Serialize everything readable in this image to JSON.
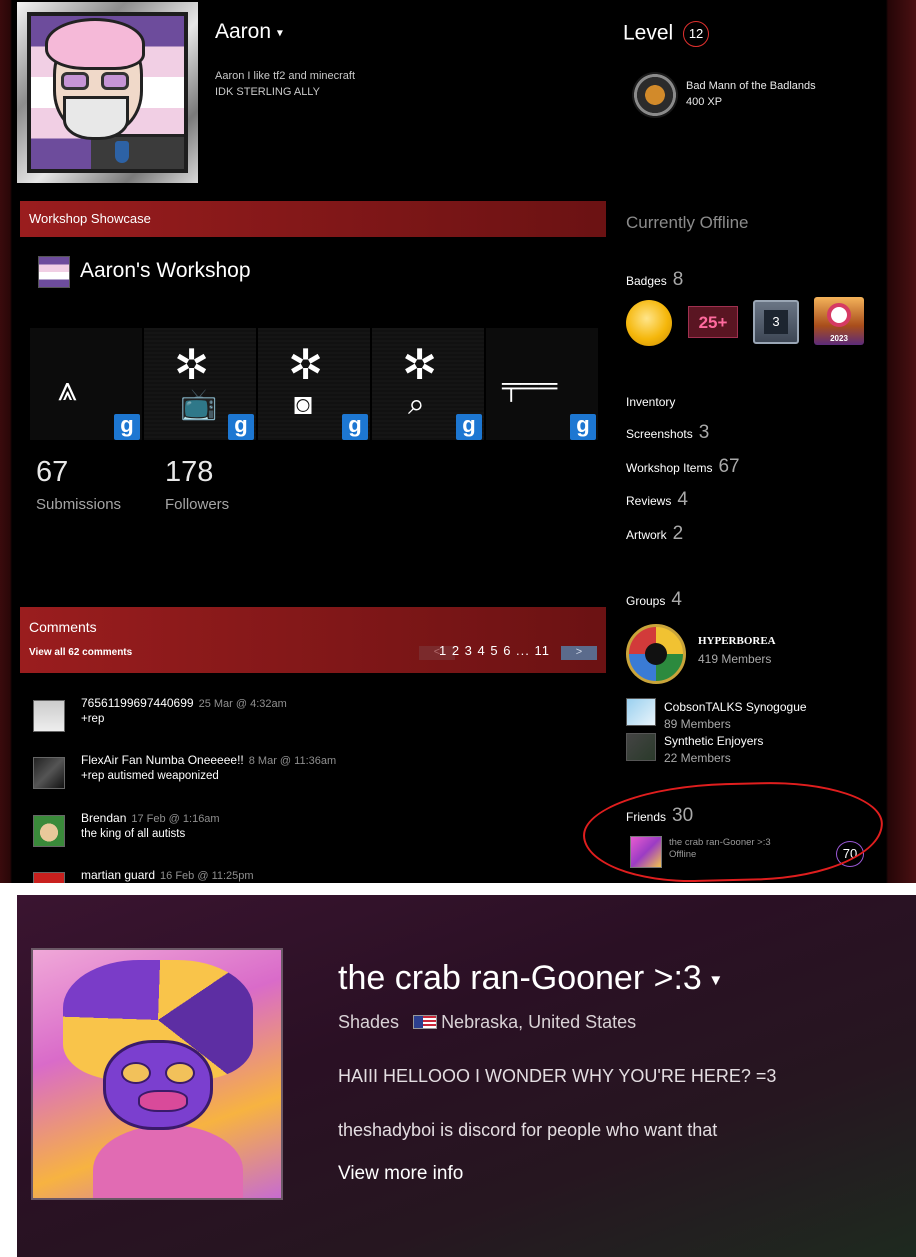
{
  "profile": {
    "name": "Aaron",
    "summary_line1": "Aaron I like tf2 and minecraft",
    "summary_line2": "IDK STERLING ALLY",
    "level_label": "Level",
    "level": "12",
    "xp_badge": {
      "name": "Bad Mann of the Badlands",
      "xp": "400 XP"
    },
    "status": "Currently Offline"
  },
  "workshop": {
    "header": "Workshop Showcase",
    "title": "Aaron's Workshop",
    "items": [
      {
        "symbol": "⩓",
        "sub": "",
        "icon": "gmod-g-icon"
      },
      {
        "symbol": "✲",
        "sub": "📺",
        "icon": "gmod-g-icon"
      },
      {
        "symbol": "✲",
        "sub": "◙",
        "icon": "gmod-g-icon"
      },
      {
        "symbol": "✲",
        "sub": "⌕",
        "icon": "gmod-g-icon"
      },
      {
        "symbol": "╤══",
        "sub": "",
        "icon": "gmod-g-icon"
      }
    ],
    "g_label": "g",
    "stats": [
      {
        "value": "67",
        "label": "Submissions"
      },
      {
        "value": "178",
        "label": "Followers"
      }
    ]
  },
  "comments": {
    "header": "Comments",
    "view_all": "View all 62 comments",
    "pagination": {
      "prev": "<",
      "next": ">",
      "pages": "1 2 3 4 5 6 ... 11",
      "current": "1"
    },
    "items": [
      {
        "author": "76561199697440699",
        "date": "25 Mar @ 4:32am",
        "text": "+rep"
      },
      {
        "author": "FlexAir Fan Numba Oneeeee!!",
        "date": "8 Mar @ 11:36am",
        "text": "+rep autismed weaponized"
      },
      {
        "author": "Brendan",
        "date": "17 Feb @ 1:16am",
        "text": "the king of all autists"
      },
      {
        "author": "martian guard",
        "date": "16 Feb @ 11:25pm",
        "text": ""
      }
    ]
  },
  "sidebar": {
    "badges": {
      "label": "Badges",
      "count": "8",
      "b2": "25+",
      "b3": "3",
      "b4_year": "2023"
    },
    "links": [
      {
        "label": "Inventory",
        "count": ""
      },
      {
        "label": "Screenshots",
        "count": "3"
      },
      {
        "label": "Workshop Items",
        "count": "67"
      },
      {
        "label": "Reviews",
        "count": "4"
      },
      {
        "label": "Artwork",
        "count": "2"
      }
    ],
    "groups": {
      "label": "Groups",
      "count": "4",
      "featured": {
        "name": "HYPERBOREA",
        "members": "419 Members"
      },
      "others": [
        {
          "name": "CobsonTALKS Synogogue",
          "members": "89 Members"
        },
        {
          "name": "Synthetic Enjoyers",
          "members": "22 Members"
        }
      ]
    },
    "friends": {
      "label": "Friends",
      "count": "30",
      "first": {
        "name": "the crab ran-Gooner >:3",
        "status": "Offline",
        "level": "70"
      }
    }
  },
  "crab_profile": {
    "name": "the crab ran-Gooner >:3",
    "real_name": "Shades",
    "location": "Nebraska, United States",
    "summary_line1": "HAIII HELLOOO I WONDER WHY YOU'RE HERE? =3",
    "summary_line2": "theshadyboi is discord for people who want that",
    "view_more": "View more info"
  },
  "colors": {
    "accent_red": "#9a1d1e",
    "highlight_red": "#e01e1e",
    "level_purple": "#9b58d6",
    "gmod_blue": "#1d77d2"
  }
}
